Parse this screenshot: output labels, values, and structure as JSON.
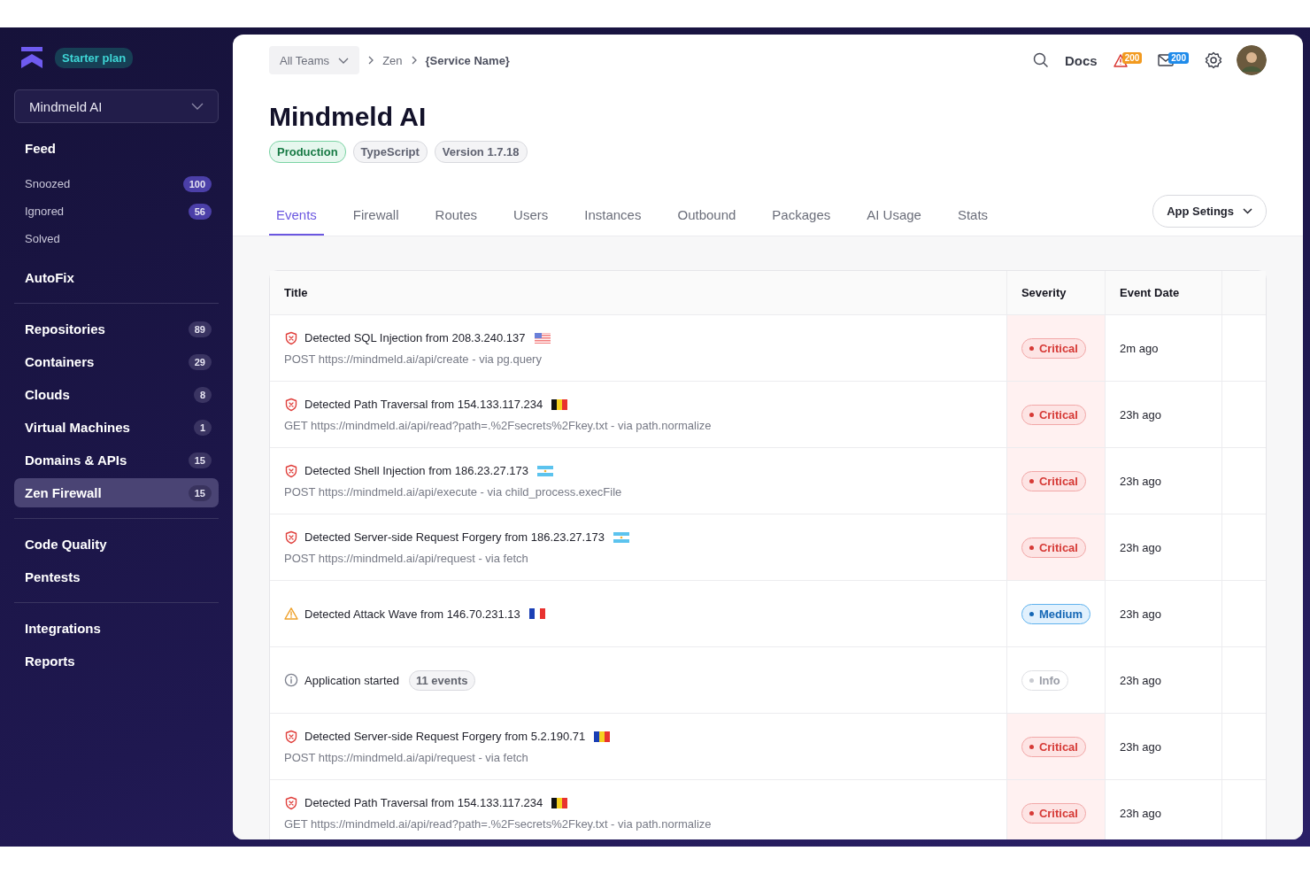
{
  "sidebar": {
    "plan": "Starter plan",
    "workspace": "Mindmeld AI",
    "groups": [
      [
        {
          "label": "Feed",
          "kind": "main",
          "selected": false
        },
        {
          "label": "Snoozed",
          "kind": "sub",
          "count": "100",
          "selected": false
        },
        {
          "label": "Ignored",
          "kind": "sub",
          "count": "56",
          "selected": false
        },
        {
          "label": "Solved",
          "kind": "sub",
          "selected": false
        },
        {
          "label": "AutoFix",
          "kind": "main",
          "selected": false
        }
      ],
      [
        {
          "label": "Repositories",
          "kind": "main",
          "count": "89",
          "selected": false
        },
        {
          "label": "Containers",
          "kind": "main",
          "count": "29",
          "selected": false
        },
        {
          "label": "Clouds",
          "kind": "main",
          "count": "8",
          "selected": false
        },
        {
          "label": "Virtual Machines",
          "kind": "main",
          "count": "1",
          "selected": false
        },
        {
          "label": "Domains & APIs",
          "kind": "main",
          "count": "15",
          "selected": false
        },
        {
          "label": "Zen Firewall",
          "kind": "main",
          "count": "15",
          "selected": true
        }
      ],
      [
        {
          "label": "Code Quality",
          "kind": "main",
          "selected": false
        },
        {
          "label": "Pentests",
          "kind": "main",
          "selected": false
        }
      ],
      [
        {
          "label": "Integrations",
          "kind": "main",
          "selected": false
        },
        {
          "label": "Reports",
          "kind": "main",
          "selected": false
        }
      ]
    ]
  },
  "topbar": {
    "team": "All Teams",
    "crumbs": [
      "Zen",
      "{Service Name}"
    ],
    "docs": "Docs",
    "alerts": "200",
    "messages": "200"
  },
  "title": "Mindmeld AI",
  "tags": [
    {
      "label": "Production",
      "kind": "env"
    },
    {
      "label": "TypeScript",
      "kind": "plain"
    },
    {
      "label": "Version 1.7.18",
      "kind": "plain"
    }
  ],
  "tabs": [
    {
      "label": "Events",
      "selected": true
    },
    {
      "label": "Firewall",
      "selected": false
    },
    {
      "label": "Routes",
      "selected": false
    },
    {
      "label": "Users",
      "selected": false
    },
    {
      "label": "Instances",
      "selected": false
    },
    {
      "label": "Outbound",
      "selected": false
    },
    {
      "label": "Packages",
      "selected": false
    },
    {
      "label": "AI Usage",
      "selected": false
    },
    {
      "label": "Stats",
      "selected": false
    }
  ],
  "settings_button": "App Setings",
  "table": {
    "columns": [
      "Title",
      "Severity",
      "Event Date"
    ],
    "rows": [
      {
        "kind": "critical",
        "title": "Detected SQL Injection from 208.3.240.137",
        "flag": {
          "kind": "us"
        },
        "detail": "POST https://mindmeld.ai/api/create - via pg.query",
        "severity": "Critical",
        "date": "2m ago"
      },
      {
        "kind": "critical",
        "title": "Detected Path Traversal from 154.133.117.234",
        "flag": {
          "kind": "be"
        },
        "detail": "GET https://mindmeld.ai/api/read?path=.%2Fsecrets%2Fkey.txt - via path.normalize",
        "severity": "Critical",
        "date": "23h ago"
      },
      {
        "kind": "critical",
        "title": "Detected Shell Injection from 186.23.27.173",
        "flag": {
          "kind": "ar"
        },
        "detail": "POST https://mindmeld.ai/api/execute - via child_process.execFile",
        "severity": "Critical",
        "date": "23h ago"
      },
      {
        "kind": "critical",
        "title": "Detected Server-side Request Forgery from 186.23.27.173",
        "flag": {
          "kind": "ar"
        },
        "detail": "POST https://mindmeld.ai/api/request - via fetch",
        "severity": "Critical",
        "date": "23h ago"
      },
      {
        "kind": "medium",
        "title": "Detected Attack Wave from 146.70.231.13",
        "flag": {
          "kind": "fr"
        },
        "severity": "Medium",
        "date": "23h ago"
      },
      {
        "kind": "info",
        "title": "Application started",
        "count": "11 events",
        "severity": "Info",
        "date": "23h ago"
      },
      {
        "kind": "critical",
        "title": "Detected Server-side Request Forgery from 5.2.190.71",
        "flag": {
          "kind": "ro"
        },
        "detail": "POST https://mindmeld.ai/api/request - via fetch",
        "severity": "Critical",
        "date": "23h ago"
      },
      {
        "kind": "critical",
        "title": "Detected Path Traversal from 154.133.117.234",
        "flag": {
          "kind": "be"
        },
        "detail": "GET https://mindmeld.ai/api/read?path=.%2Fsecrets%2Fkey.txt - via path.normalize",
        "severity": "Critical",
        "date": "23h ago"
      }
    ]
  }
}
